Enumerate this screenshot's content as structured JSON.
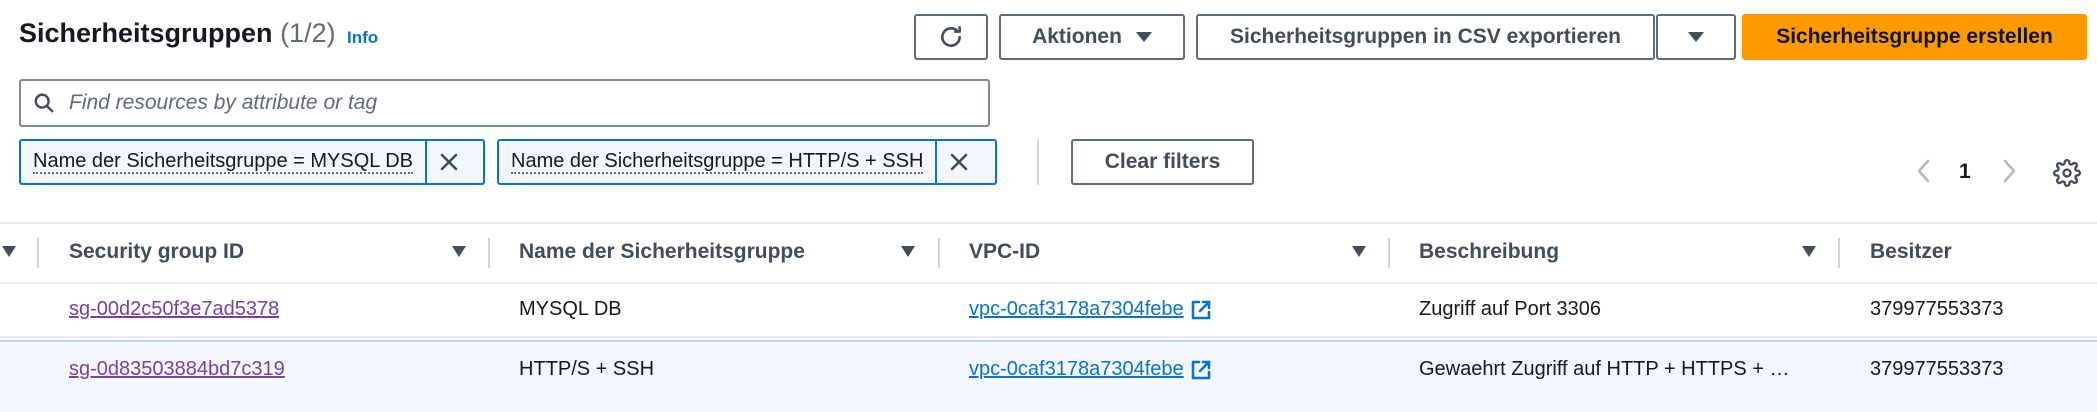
{
  "header": {
    "title": "Sicherheitsgruppen",
    "count": "(1/2)",
    "info": "Info"
  },
  "toolbar": {
    "refresh_icon": "refresh-icon",
    "actions_label": "Aktionen",
    "export_label": "Sicherheitsgruppen in CSV exportieren",
    "create_label": "Sicherheitsgruppe erstellen",
    "primary_color": "#ff9900"
  },
  "search": {
    "placeholder": "Find resources by attribute or tag",
    "value": ""
  },
  "filters": {
    "tokens": [
      {
        "label": "Name der Sicherheitsgruppe = MYSQL DB"
      },
      {
        "label": "Name der Sicherheitsgruppe = HTTP/S + SSH"
      }
    ],
    "clear_label": "Clear filters"
  },
  "pagination": {
    "current_page": "1"
  },
  "table": {
    "columns": [
      "Security group ID",
      "Name der Sicherheitsgruppe",
      "VPC-ID",
      "Beschreibung",
      "Besitzer"
    ],
    "rows": [
      {
        "id": "sg-00d2c50f3e7ad5378",
        "name": "MYSQL DB",
        "vpc": "vpc-0caf3178a7304febe",
        "description": "Zugriff auf Port 3306",
        "owner": "379977553373"
      },
      {
        "id": "sg-0d83503884bd7c319",
        "name": "HTTP/S + SSH",
        "vpc": "vpc-0caf3178a7304febe",
        "description": "Gewaehrt Zugriff auf HTTP + HTTPS + …",
        "owner": "379977553373"
      }
    ]
  }
}
